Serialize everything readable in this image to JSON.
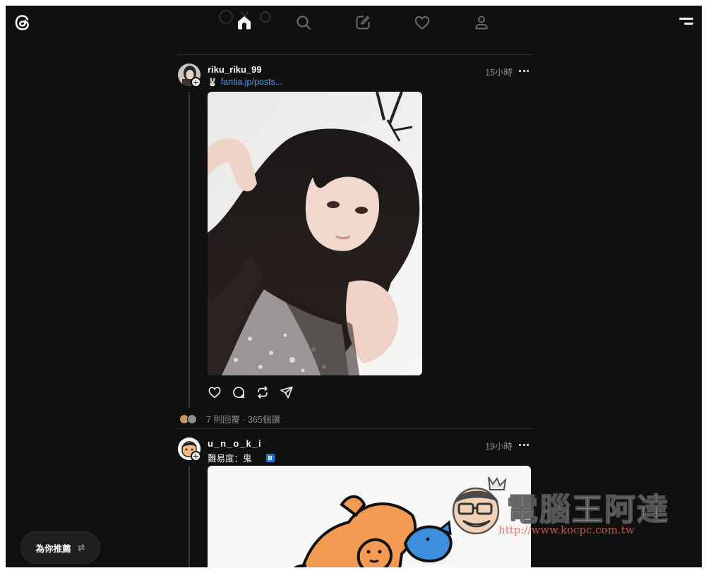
{
  "header": {
    "logo_icon": "threads-logo-icon",
    "nav": [
      {
        "name": "home",
        "icon": "home-icon",
        "active": true
      },
      {
        "name": "search",
        "icon": "search-icon",
        "active": false
      },
      {
        "name": "compose",
        "icon": "compose-icon",
        "active": false
      },
      {
        "name": "activity",
        "icon": "heart-icon",
        "active": false
      },
      {
        "name": "profile",
        "icon": "person-icon",
        "active": false
      }
    ],
    "menu_icon": "menu-icon"
  },
  "posts": [
    {
      "username": "riku_riku_99",
      "time": "15小時",
      "link_emoji": "🐰",
      "link_text": "fantia.jp/posts...",
      "stats": "7 則回覆 · 365個讚"
    },
    {
      "username": "u_n_o_k_i",
      "time": "19小時",
      "text": "難易度：鬼"
    }
  ],
  "feed_switch": {
    "label": "為你推薦",
    "icon": "swap-icon"
  },
  "watermark": {
    "text": "電腦王阿達",
    "url": "http://www.kocpc.com.tw"
  },
  "colors": {
    "background": "#101010",
    "text_primary": "#f3f5f7",
    "text_secondary": "#8a8a8a",
    "link": "#4f9cf5",
    "divider": "#2d2d2d"
  }
}
